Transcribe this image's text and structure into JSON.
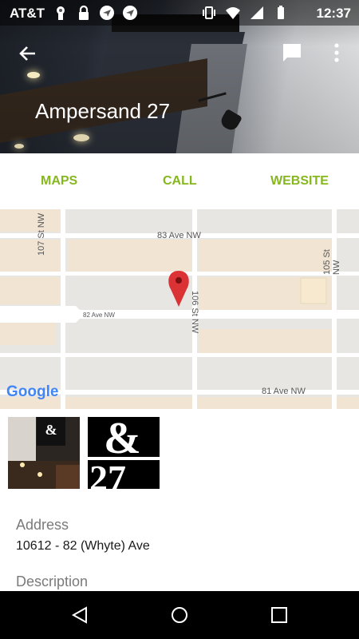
{
  "status_bar": {
    "carrier": "AT&T",
    "time": "12:37",
    "left_icons": [
      "keyhole-icon",
      "lock-icon",
      "send-icon",
      "send-icon"
    ],
    "right_icons": [
      "vibrate-icon",
      "wifi-icon",
      "signal-icon",
      "battery-icon"
    ]
  },
  "header": {
    "title": "Ampersand 27",
    "back_icon": "arrow-back-icon",
    "chat_icon": "chat-icon",
    "more_icon": "more-vert-icon"
  },
  "actions": {
    "maps": "MAPS",
    "call": "CALL",
    "website": "WEBSITE",
    "accent_color": "#86b71f"
  },
  "map": {
    "streets": {
      "ave83": "83 Ave NW",
      "ave82": "82 Ave NW",
      "ave81": "81 Ave NW",
      "st107": "107 St NW",
      "st106": "106 St NW",
      "st105": "105 St NW"
    },
    "logo": "Google",
    "pin_color": "#db3236"
  },
  "details": {
    "address_label": "Address",
    "address_value": "10612 - 82 (Whyte) Ave",
    "description_label": "Description"
  },
  "thumbnail_text": "&27",
  "nav": {
    "back": "nav-back-icon",
    "home": "nav-home-icon",
    "recents": "nav-recents-icon"
  }
}
